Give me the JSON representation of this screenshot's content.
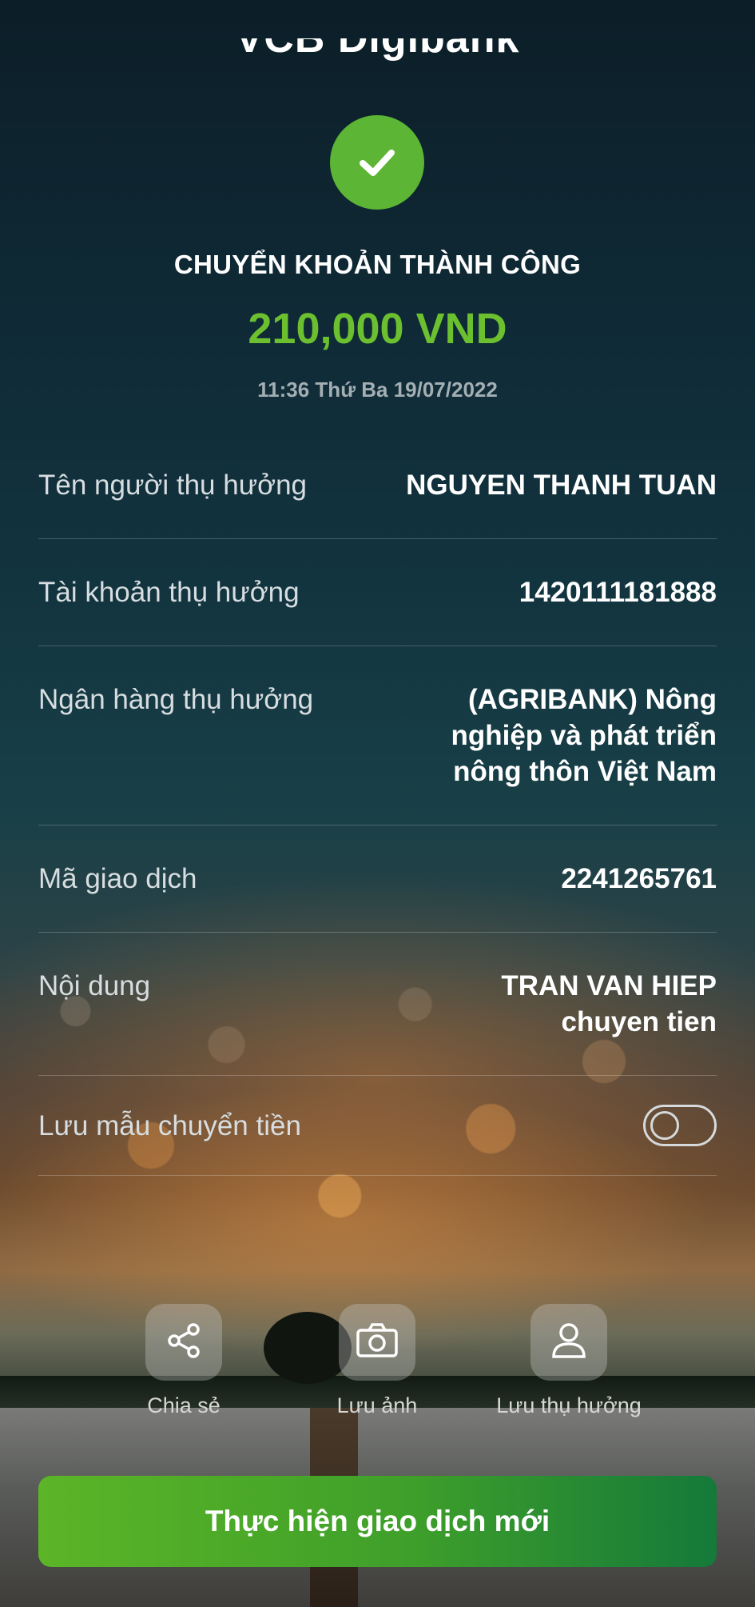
{
  "header": {
    "logo_text": "VCB Digibank"
  },
  "status": {
    "title": "CHUYỂN KHOẢN THÀNH CÔNG",
    "amount": "210,000 VND",
    "datetime": "11:36 Thứ Ba 19/07/2022"
  },
  "details": [
    {
      "label": "Tên người thụ hưởng",
      "value": "NGUYEN THANH TUAN"
    },
    {
      "label": "Tài khoản thụ hưởng",
      "value": "1420111181888"
    },
    {
      "label": "Ngân hàng thụ hưởng",
      "value": "(AGRIBANK) Nông nghiệp và phát triển nông thôn Việt Nam"
    },
    {
      "label": "Mã giao dịch",
      "value": "2241265761"
    },
    {
      "label": "Nội dung",
      "value": "TRAN VAN HIEP chuyen tien"
    }
  ],
  "save_template": {
    "label": "Lưu mẫu chuyển tiền",
    "enabled": false
  },
  "actions": [
    {
      "label": "Chia sẻ",
      "icon": "share-icon"
    },
    {
      "label": "Lưu ảnh",
      "icon": "camera-icon"
    },
    {
      "label": "Lưu thụ hưởng",
      "icon": "user-icon"
    }
  ],
  "cta": {
    "label": "Thực hiện giao dịch mới"
  },
  "colors": {
    "success": "#5cb534",
    "amount": "#6cc030",
    "cta_start": "#5cb527",
    "cta_end": "#15793a"
  }
}
